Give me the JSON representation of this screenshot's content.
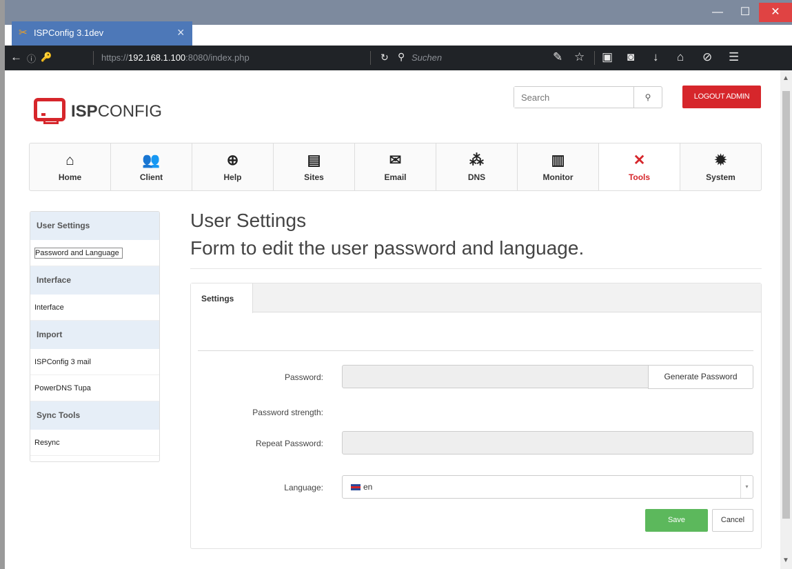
{
  "browser": {
    "tab_title": "ISPConfig 3.1dev",
    "url_prefix": "https://",
    "url_host": "192.168.1.100",
    "url_rest": ":8080/index.php",
    "search_placeholder": "Suchen"
  },
  "header": {
    "logo_bold": "ISP",
    "logo_light": "CONFIG",
    "search_placeholder": "Search",
    "logout_label": "LOGOUT ADMIN"
  },
  "mainnav": [
    {
      "label": "Home",
      "icon": "home-icon",
      "glyph": "⌂"
    },
    {
      "label": "Client",
      "icon": "users-icon",
      "glyph": "👥"
    },
    {
      "label": "Help",
      "icon": "lifebuoy-icon",
      "glyph": "⊕"
    },
    {
      "label": "Sites",
      "icon": "browser-window-icon",
      "glyph": "▤"
    },
    {
      "label": "Email",
      "icon": "envelope-icon",
      "glyph": "✉"
    },
    {
      "label": "DNS",
      "icon": "network-icon",
      "glyph": "⁂"
    },
    {
      "label": "Monitor",
      "icon": "traffic-light-icon",
      "glyph": "▥"
    },
    {
      "label": "Tools",
      "icon": "tools-icon",
      "glyph": "✕"
    },
    {
      "label": "System",
      "icon": "gear-icon",
      "glyph": "✹"
    }
  ],
  "active_nav": "Tools",
  "sidebar": {
    "sections": [
      {
        "header": "User Settings",
        "items": [
          "Password and Language"
        ]
      },
      {
        "header": "Interface",
        "items": [
          "Interface"
        ]
      },
      {
        "header": "Import",
        "items": [
          "ISPConfig 3 mail",
          "PowerDNS Tupa"
        ]
      },
      {
        "header": "Sync Tools",
        "items": [
          "Resync"
        ]
      }
    ]
  },
  "main": {
    "title": "User Settings",
    "subtitle": "Form to edit the user password and language.",
    "tab_label": "Settings",
    "password_label": "Password:",
    "password_value": "",
    "generate_label": "Generate Password",
    "strength_label": "Password strength:",
    "repeat_label": "Repeat Password:",
    "repeat_value": "",
    "language_label": "Language:",
    "language_value": "en",
    "save_label": "Save",
    "cancel_label": "Cancel"
  }
}
